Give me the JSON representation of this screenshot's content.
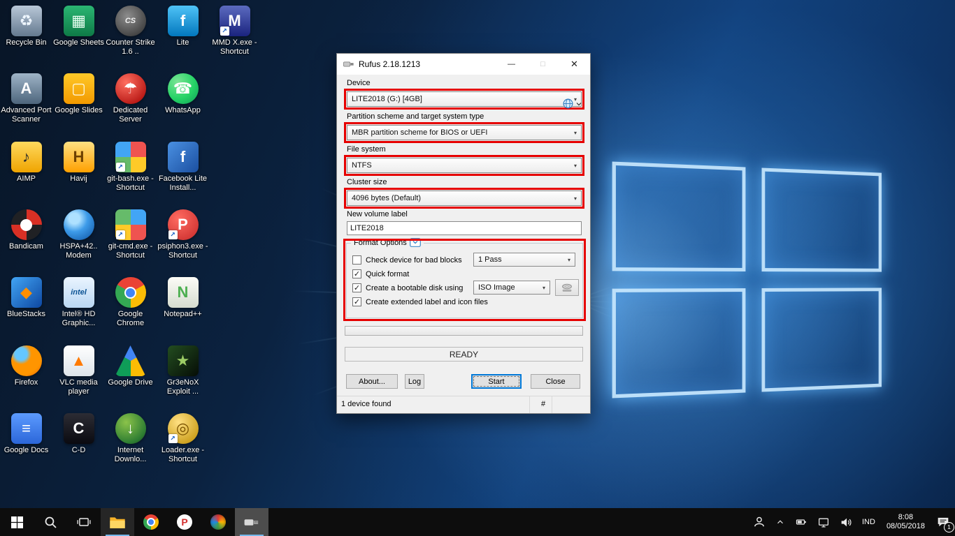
{
  "icons": {
    "combo_chevron": "▾"
  },
  "colors": {
    "annotation_red": "#e60000",
    "focus_blue": "#0078d7",
    "taskbar_underline": "#76b9ed"
  },
  "desktop": {
    "shortcut_glyph": "↗",
    "columns": [
      [
        {
          "id": "recycle-bin",
          "label": "Recycle Bin",
          "glyph": "♻",
          "fg": "#eef6ff",
          "bg": "linear-gradient(180deg,#b9c8d8,#64798f)"
        },
        {
          "id": "advanced-port-scanner",
          "label": "Advanced Port Scanner",
          "glyph": "A",
          "fg": "#ffffff",
          "bg": "linear-gradient(180deg,#9fb4c7,#4d657c)"
        },
        {
          "id": "aimp",
          "label": "AIMP",
          "glyph": "♪",
          "fg": "#2b2b2b",
          "bg": "linear-gradient(180deg,#ffd95e,#efa400)"
        },
        {
          "id": "bandicam",
          "label": "Bandicam",
          "shape": "circle",
          "dot": "#ffffff",
          "bg": "conic-gradient(#d93025 0 25%, #202124 25% 50%, #d93025 50% 75%, #202124 75%)"
        },
        {
          "id": "bluestacks",
          "label": "BlueStacks",
          "glyph": "◆",
          "fg": "#ff8f00",
          "bg": "linear-gradient(135deg,#42a5f5,#0d47a1)"
        },
        {
          "id": "firefox",
          "label": "Firefox",
          "shape": "circle",
          "bg": "radial-gradient(circle at 32% 28%, #64c7ff 0 20%, #ff9500 34% 68%, #e55b00 100%)"
        },
        {
          "id": "google-docs",
          "label": "Google Docs",
          "glyph": "≡",
          "fg": "#ffffff",
          "bg": "linear-gradient(180deg,#5c9bff,#2b66d9)"
        }
      ],
      [
        {
          "id": "google-sheets",
          "label": "Google Sheets",
          "glyph": "▦",
          "fg": "#eafff3",
          "bg": "linear-gradient(180deg,#2bb673,#0e7a47)"
        },
        {
          "id": "google-slides",
          "label": "Google Slides",
          "glyph": "▢",
          "fg": "#fff8e1",
          "bg": "linear-gradient(180deg,#ffc928,#f29900)"
        },
        {
          "id": "havij",
          "label": "Havij",
          "glyph": "H",
          "fg": "#6d3f00",
          "bg": "linear-gradient(180deg,#ffe082,#ffa000)"
        },
        {
          "id": "hspa-modem",
          "label": "HSPA+42.. Modem",
          "shape": "circle",
          "bg": "radial-gradient(circle at 35% 30%, #aee1ff 0 18%, #3d9be9 45%, #0b4f9e 100%)"
        },
        {
          "id": "intel-hd-graphics",
          "label": "Intel® HD Graphic...",
          "glyph": "intel",
          "small": true,
          "fg": "#0b5394",
          "bg": "linear-gradient(180deg,#eaf4ff,#b9d7f3)"
        },
        {
          "id": "vlc-media-player",
          "label": "VLC media player",
          "glyph": "▲",
          "fg": "#ff7a00",
          "bg": "linear-gradient(180deg,#ffffff,#dde4ea)"
        },
        {
          "id": "c-d",
          "label": "C-D",
          "glyph": "C",
          "fg": "#ffffff",
          "bg": "linear-gradient(180deg,#2c2c34,#0a0a10)"
        }
      ],
      [
        {
          "id": "counter-strike",
          "label": "Counter Strike 1.6 ..",
          "glyph": "CS",
          "small": true,
          "shape": "circle",
          "fg": "#f2f2f2",
          "bg": "radial-gradient(circle at 40% 35%, #8d8d8d, #2b2b2b)"
        },
        {
          "id": "dedicated-server",
          "label": "Dedicated Server",
          "glyph": "☂",
          "fg": "#ffffff",
          "shape": "circle",
          "bg": "radial-gradient(circle at 35% 30%, #ff6f60, #a30000)"
        },
        {
          "id": "git-bash",
          "label": "git-bash.exe - Shortcut",
          "shortcut": true,
          "bg": "conic-gradient(#ef5350 0 25%, #ffca28 25% 50%, #66bb6a 50% 75%, #42a5f5 75%)"
        },
        {
          "id": "git-cmd",
          "label": "git-cmd.exe - Shortcut",
          "shortcut": true,
          "bg": "conic-gradient(#42a5f5 0 25%, #ef5350 25% 50%, #ffca28 50% 75%, #66bb6a 75%)"
        },
        {
          "id": "google-chrome",
          "label": "Google Chrome",
          "shape": "circle",
          "dot": "#4285f4",
          "bg": "conic-gradient(from -60deg, #ea4335 0 120deg, #fbbc05 120deg 240deg, #34a853 240deg 360deg)"
        },
        {
          "id": "google-drive",
          "label": "Google Drive",
          "clip": "triangle",
          "bg": "conic-gradient(from 180deg, #0f9d58 0 120deg, #4285f4 120deg 240deg, #fbbc04 240deg)"
        },
        {
          "id": "internet-download-manager",
          "label": "Internet Downlo...",
          "glyph": "↓",
          "fg": "#ffffff",
          "shape": "circle",
          "bg": "radial-gradient(circle at 35% 30%, #8bc34a, #2e7d32 70%, #173f19)"
        }
      ],
      [
        {
          "id": "lite",
          "label": "Lite",
          "glyph": "f",
          "fg": "#ffffff",
          "bg": "linear-gradient(180deg,#4fc3f7,#0277bd)"
        },
        {
          "id": "whatsapp",
          "label": "WhatsApp",
          "glyph": "☎",
          "fg": "#ffffff",
          "shape": "circle",
          "bg": "radial-gradient(circle at 32% 28%, #7be495, #25d366 55%, #0f9b57)"
        },
        {
          "id": "facebook-lite-installer",
          "label": "Facebook Lite Install...",
          "glyph": "f",
          "fg": "#ffffff",
          "bg": "linear-gradient(135deg,#4a90e2,#1b4fa0)"
        },
        {
          "id": "psiphon3",
          "label": "psiphon3.exe - Shortcut",
          "glyph": "P",
          "fg": "#ffffff",
          "shape": "circle",
          "shortcut": true,
          "bg": "radial-gradient(circle at 35% 30%, #ff6b61, #c62828)"
        },
        {
          "id": "notepad-plus-plus",
          "label": "Notepad++",
          "glyph": "N",
          "fg": "#4caf50",
          "bg": "linear-gradient(180deg,#fcfcf7,#d5dccf)"
        },
        {
          "id": "gr3enox-exploit",
          "label": "Gr3eNoX Exploit ...",
          "glyph": "★",
          "fg": "#9ccc65",
          "bg": "linear-gradient(135deg,#234d20,#060d06)"
        },
        {
          "id": "loader-exe",
          "label": "Loader.exe - Shortcut",
          "glyph": "◎",
          "fg": "#7a5200",
          "shape": "circle",
          "shortcut": true,
          "bg": "radial-gradient(circle at 35% 30%, #ffe082, #bd8c00)"
        }
      ],
      [
        {
          "id": "mmd-x",
          "label": "MMD X.exe - Shortcut",
          "glyph": "M",
          "fg": "#ffffff",
          "shortcut": true,
          "bg": "linear-gradient(180deg,#5c6bc0,#1a237e)"
        }
      ]
    ]
  },
  "rufus": {
    "title": "Rufus 2.18.1213",
    "controls": {
      "minimize": "—",
      "maximize": "□",
      "close": "✕"
    },
    "fields": [
      {
        "id": "device",
        "label": "Device",
        "type": "select",
        "value": "LITE2018 (G:) [4GB]",
        "annotated": true
      },
      {
        "id": "partition-scheme",
        "label": "Partition scheme and target system type",
        "type": "select",
        "value": "MBR partition scheme for BIOS or UEFI",
        "annotated": true
      },
      {
        "id": "file-system",
        "label": "File system",
        "type": "select",
        "value": "NTFS",
        "annotated": true
      },
      {
        "id": "cluster-size",
        "label": "Cluster size",
        "type": "select",
        "value": "4096 bytes (Default)",
        "annotated": true
      },
      {
        "id": "volume-label",
        "label": "New volume label",
        "type": "text",
        "value": "LITE2018",
        "annotated": false
      }
    ],
    "format_options": {
      "title": "Format Options",
      "items": [
        {
          "label": "Check device for bad blocks",
          "checked": false,
          "select": "1 Pass"
        },
        {
          "label": "Quick format",
          "checked": true
        },
        {
          "label": "Create a bootable disk using",
          "checked": true,
          "select": "ISO Image"
        },
        {
          "label": "Create extended label and icon files",
          "checked": true
        }
      ]
    },
    "status_text": "READY",
    "buttons": {
      "about": "About...",
      "log": "Log",
      "start": "Start",
      "close": "Close"
    },
    "statusbar": {
      "left": "1 device found",
      "right": "#"
    }
  },
  "taskbar": {
    "psiphon_glyph": "P",
    "tray": {
      "language": "IND",
      "time": "8:08",
      "date": "08/05/2018",
      "notification_badge": "1"
    }
  }
}
